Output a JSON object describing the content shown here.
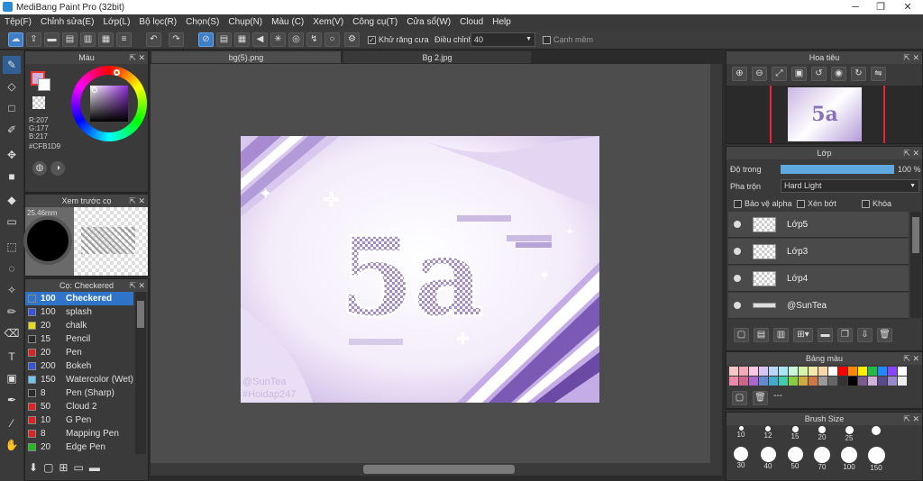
{
  "app": {
    "title": "MediBang Paint Pro (32bit)"
  },
  "menu": [
    "Tệp(F)",
    "Chỉnh sửa(E)",
    "Lớp(L)",
    "Bộ lọc(R)",
    "Chọn(S)",
    "Chụp(N)",
    "Màu (C)",
    "Xem(V)",
    "Công cụ(T)",
    "Cửa sổ(W)",
    "Cloud",
    "Help"
  ],
  "toolbar": {
    "antialias_label": "Khử răng cưa",
    "adjust_label": "Điều chỉnh",
    "adjust_value": "40",
    "edge_label": "Cạnh mềm"
  },
  "color_panel": {
    "title": "Màu",
    "r": "R:207",
    "g": "G:177",
    "b": "B:217",
    "hex": "#CFB1D9",
    "fg_color": "#CFB1D9"
  },
  "preview_panel": {
    "title": "Xem trước cọ",
    "size": "25.46mm"
  },
  "brush_panel": {
    "title": "Cọ: Checkered",
    "brushes": [
      {
        "size": "100",
        "name": "Checkered",
        "color": "#2f74c8"
      },
      {
        "size": "100",
        "name": "splash",
        "color": "#3355dd"
      },
      {
        "size": "20",
        "name": "chalk",
        "color": "#e8d81a"
      },
      {
        "size": "15",
        "name": "Pencil",
        "color": "#2a2a2a"
      },
      {
        "size": "20",
        "name": "Pen",
        "color": "#dd2222"
      },
      {
        "size": "200",
        "name": "Bokeh",
        "color": "#3355dd"
      },
      {
        "size": "150",
        "name": "Watercolor (Wet)",
        "color": "#6ec6f0"
      },
      {
        "size": "8",
        "name": "Pen (Sharp)",
        "color": "#2a2a2a"
      },
      {
        "size": "50",
        "name": "Cloud 2",
        "color": "#dd2222"
      },
      {
        "size": "10",
        "name": "G Pen",
        "color": "#dd2222"
      },
      {
        "size": "8",
        "name": "Mapping Pen",
        "color": "#dd2222"
      },
      {
        "size": "20",
        "name": "Edge Pen",
        "color": "#22bb22"
      }
    ]
  },
  "tabs": [
    {
      "label": "bg(5).png"
    },
    {
      "label": "Bg 2.jpg"
    }
  ],
  "artwork": {
    "main_text": "5a",
    "watermark_1": "@SunTea",
    "watermark_2": "#Hoidap247"
  },
  "navigator": {
    "title": "Hoa tiêu"
  },
  "layer_panel": {
    "title": "Lớp",
    "opacity_label": "Độ trong",
    "opacity_value": "100 %",
    "opacity": 1.0,
    "blend_label": "Pha trộn",
    "blend_value": "Hard Light",
    "protect_alpha": "Bảo vệ alpha",
    "clipping": "Xén bớt",
    "lock": "Khóa",
    "layers": [
      {
        "name": "Lớp5"
      },
      {
        "name": "Lớp3"
      },
      {
        "name": "Lớp4"
      },
      {
        "name": "@SunTea"
      }
    ]
  },
  "palette_panel": {
    "title": "Bảng màu",
    "extra": "---",
    "colors": [
      "#f7c6c6",
      "#f4a9b9",
      "#f7c9e2",
      "#d7c6f4",
      "#b9d6f7",
      "#a9e6f4",
      "#c6f7d8",
      "#d8f4a9",
      "#f4eaa9",
      "#f7d6a9",
      "#ffffff",
      "#ff0000",
      "#ff8800",
      "#ffee00",
      "#22bb44",
      "#2288ff",
      "#8844ff",
      "#ffffff",
      "#ee88aa",
      "#cc6688",
      "#aa66cc",
      "#6688cc",
      "#44aacc",
      "#44ccaa",
      "#88cc44",
      "#ccaa44",
      "#cc7744",
      "#999999",
      "#666666",
      "#333333",
      "#000000",
      "#7a5c8c",
      "#cfb1d9",
      "#5a4a8a",
      "#9988cc",
      "#eeeeee"
    ]
  },
  "brush_size_panel": {
    "title": "Brush Size",
    "row1": [
      "10",
      "12",
      "15",
      "20",
      "25"
    ],
    "row2": [
      "30",
      "40",
      "50",
      "70",
      "100",
      "150"
    ]
  }
}
